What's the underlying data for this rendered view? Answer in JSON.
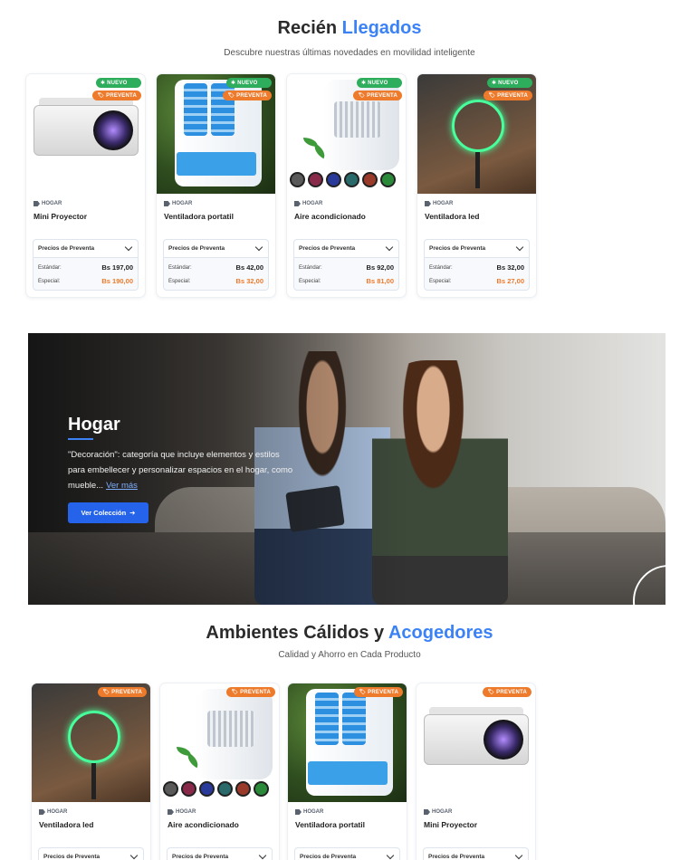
{
  "section1": {
    "title_main": "Recién ",
    "title_accent": "Llegados",
    "subtitle": "Descubre nuestras últimas novedades en movilidad inteligente",
    "products": [
      {
        "name": "Mini Proyector",
        "category": "HOGAR",
        "badge_new": "NUEVO",
        "badge_pre": "PREVENTA",
        "price_head": "Precios de Preventa",
        "std_label": "Estándar:",
        "std": "Bs 197,00",
        "spec_label": "Especial:",
        "spec": "Bs 190,00"
      },
      {
        "name": "Ventiladora portatil",
        "category": "HOGAR",
        "badge_new": "NUEVO",
        "badge_pre": "PREVENTA",
        "price_head": "Precios de Preventa",
        "std_label": "Estándar:",
        "std": "Bs 42,00",
        "spec_label": "Especial:",
        "spec": "Bs 32,00"
      },
      {
        "name": "Aire acondicionado",
        "category": "HOGAR",
        "badge_new": "NUEVO",
        "badge_pre": "PREVENTA",
        "price_head": "Precios de Preventa",
        "std_label": "Estándar:",
        "std": "Bs 92,00",
        "spec_label": "Especial:",
        "spec": "Bs 81,00"
      },
      {
        "name": "Ventiladora led",
        "category": "HOGAR",
        "badge_new": "NUEVO",
        "badge_pre": "PREVENTA",
        "price_head": "Precios de Preventa",
        "std_label": "Estándar:",
        "std": "Bs 32,00",
        "spec_label": "Especial:",
        "spec": "Bs 27,00"
      }
    ]
  },
  "banner": {
    "title": "Hogar",
    "description": "\"Decoración\": categoría que incluye elementos y estilos para embellecer y personalizar espacios en el hogar, como mueble...",
    "more_link": "Ver más",
    "button_label": "Ver Colección",
    "button_arrow": "➔"
  },
  "section2": {
    "title_main": "Ambientes Cálidos y ",
    "title_accent": "Acogedores",
    "subtitle": "Calidad y Ahorro en Cada Producto",
    "products": [
      {
        "name": "Ventiladora led",
        "category": "HOGAR",
        "badge_pre": "PREVENTA",
        "price_head": "Precios de Preventa"
      },
      {
        "name": "Aire acondicionado",
        "category": "HOGAR",
        "badge_pre": "PREVENTA",
        "price_head": "Precios de Preventa"
      },
      {
        "name": "Ventiladora portatil",
        "category": "HOGAR",
        "badge_pre": "PREVENTA",
        "price_head": "Precios de Preventa"
      },
      {
        "name": "Mini Proyector",
        "category": "HOGAR",
        "badge_pre": "PREVENTA",
        "price_head": "Precios de Preventa"
      }
    ]
  },
  "icons": {
    "new_badge": "snowflake-icon",
    "pre_badge": "tag-icon",
    "category": "tag-icon",
    "dropdown": "chevron-down-icon"
  },
  "colors": {
    "accent": "#3b82f6",
    "new": "#2eae5c",
    "preventa": "#ee7a2b",
    "button": "#2563eb"
  }
}
